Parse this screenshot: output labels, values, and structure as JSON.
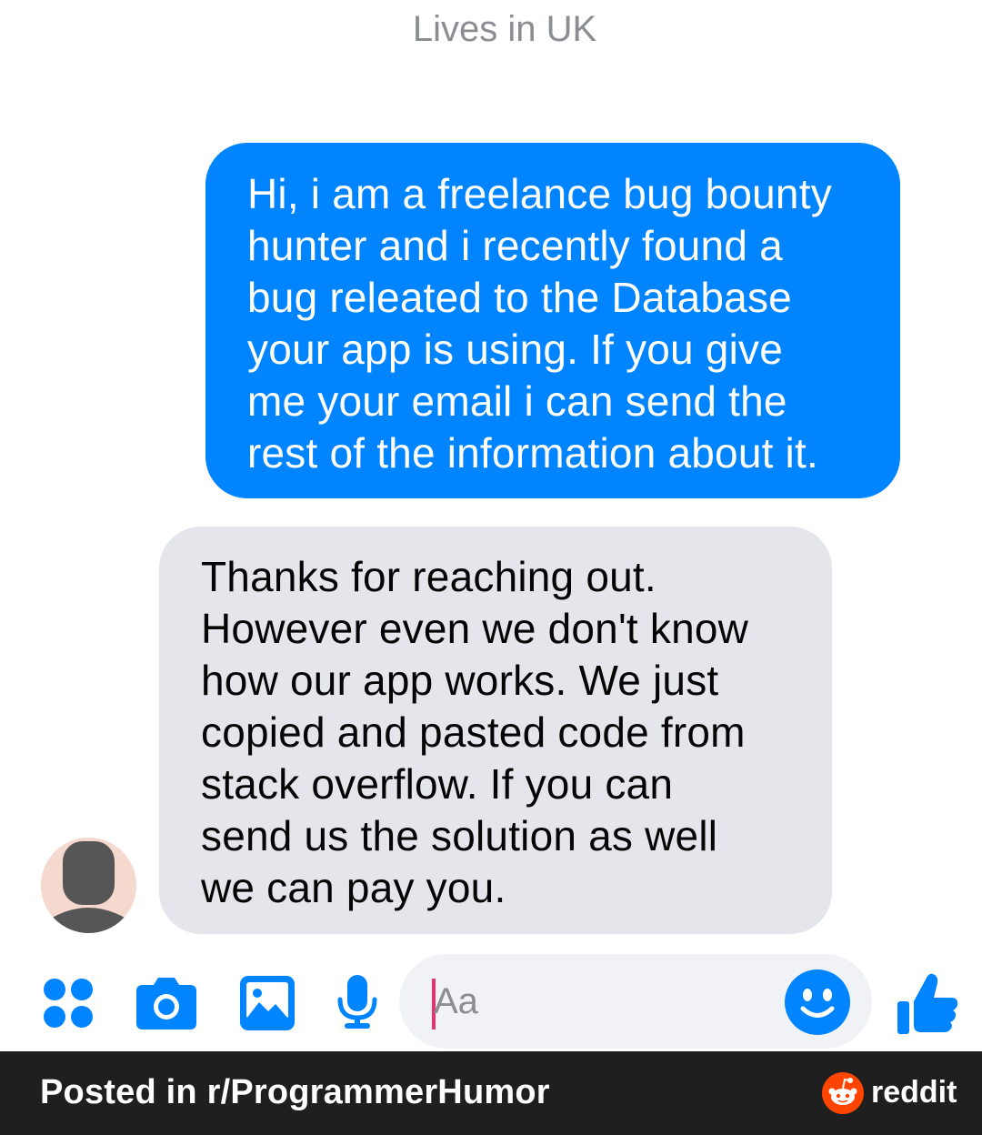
{
  "header": {
    "subtitle": "Lives in UK"
  },
  "messages": [
    {
      "sender": "me",
      "lines": [
        "Hi, i am a freelance bug bounty",
        "hunter and i recently found a",
        "bug releated to the Database",
        "your app is using. If you give",
        "me your email i can send the",
        "rest of the information about it."
      ]
    },
    {
      "sender": "them",
      "lines": [
        "Thanks for reaching out.",
        "However even we don't know",
        "how our app works. We just",
        "copied and pasted code from",
        "stack overflow. If you can",
        "send us the solution as well",
        "we can pay you."
      ]
    }
  ],
  "composer": {
    "input_placeholder": "Aa",
    "icons": [
      "apps-icon",
      "camera-icon",
      "gallery-icon",
      "microphone-icon",
      "emoji-icon",
      "thumbs-up-icon"
    ]
  },
  "footer": {
    "posted_prefix": "Posted in ",
    "subreddit": "r/ProgrammerHumor",
    "brand": "reddit"
  },
  "colors": {
    "sent_bubble": "#0084ff",
    "received_bubble": "#e4e6eb",
    "accent_blue": "#0084ff",
    "footer_bg": "#1f1f1f",
    "reddit_orange": "#ff4500",
    "caret_pink": "#e8326d"
  }
}
